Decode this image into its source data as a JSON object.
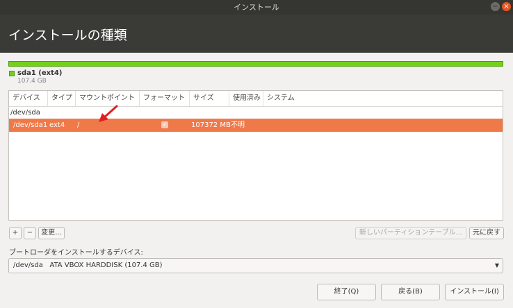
{
  "window": {
    "title": "インストール",
    "min_glyph": "−",
    "close_glyph": "×"
  },
  "header": {
    "title": "インストールの種類"
  },
  "partition_bar": {
    "color": "#73d216"
  },
  "legend": {
    "name": "sda1 (ext4)",
    "size": "107.4 GB"
  },
  "table": {
    "columns": [
      "デバイス",
      "タイプ",
      "マウントポイント",
      "フォーマット",
      "サイズ",
      "使用済み",
      "システム"
    ],
    "disk_row": {
      "device": "/dev/sda"
    },
    "partition_row": {
      "device": "/dev/sda1",
      "type": "ext4",
      "mount": "/",
      "format_checked": true,
      "format_glyph": "✓",
      "size": "107372 MB",
      "used": "不明"
    }
  },
  "buttons": {
    "add": "+",
    "remove": "−",
    "change": "変更...",
    "new_table": "新しいパーティションテーブル...",
    "revert": "元に戻す",
    "quit": "終了(Q)",
    "back": "戻る(B)",
    "install": "インストール(I)"
  },
  "bootloader": {
    "label": "ブートローダをインストールするデバイス:",
    "selected": "/dev/sda   ATA VBOX HARDDISK (107.4 GB)",
    "arrow_glyph": "▼"
  },
  "colors": {
    "selected_row": "#f0794a",
    "arrow": "#e02020"
  }
}
